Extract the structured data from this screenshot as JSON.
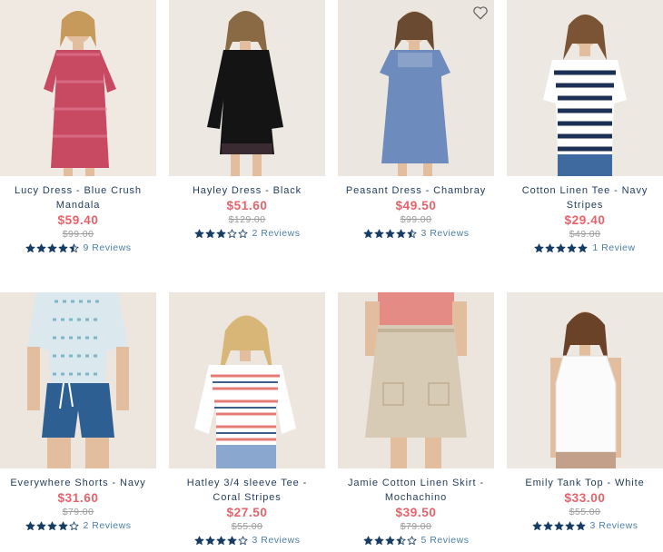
{
  "colors": {
    "price": "#e8626a",
    "was_price": "#9b9b9b",
    "name": "#1f3a5a",
    "star": "#163c64",
    "reviews": "#4c7ea8"
  },
  "icons": {
    "wishlist": "heart-outline-icon",
    "rating": "star-icon"
  },
  "products": [
    {
      "name": "Lucy Dress - Blue Crush Mandala",
      "price": "$59.40",
      "was": "$99.00",
      "rating": 4.5,
      "reviews": "9 Reviews",
      "wishlist_icon": false
    },
    {
      "name": "Hayley Dress - Black",
      "price": "$51.60",
      "was": "$129.00",
      "rating": 3,
      "reviews": "2 Reviews",
      "wishlist_icon": false
    },
    {
      "name": "Peasant Dress - Chambray",
      "price": "$49.50",
      "was": "$99.00",
      "rating": 4.5,
      "reviews": "3 Reviews",
      "wishlist_icon": true
    },
    {
      "name": "Cotton Linen Tee - Navy Stripes",
      "price": "$29.40",
      "was": "$49.00",
      "rating": 5,
      "reviews": "1 Review",
      "wishlist_icon": false
    },
    {
      "name": "Everywhere Shorts - Navy",
      "price": "$31.60",
      "was": "$79.00",
      "rating": 4,
      "reviews": "2 Reviews",
      "wishlist_icon": false
    },
    {
      "name": "Hatley 3/4 sleeve Tee - Coral Stripes",
      "price": "$27.50",
      "was": "$55.00",
      "rating": 4,
      "reviews": "3 Reviews",
      "wishlist_icon": false
    },
    {
      "name": "Jamie Cotton Linen Skirt - Mochachino",
      "price": "$39.50",
      "was": "$79.00",
      "rating": 3.5,
      "reviews": "5 Reviews",
      "wishlist_icon": false
    },
    {
      "name": "Emily Tank Top - White",
      "price": "$33.00",
      "was": "$55.00",
      "rating": 5,
      "reviews": "3 Reviews",
      "wishlist_icon": false
    }
  ]
}
